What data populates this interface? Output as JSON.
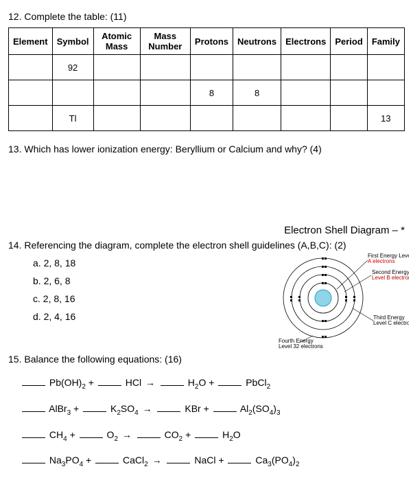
{
  "q12": {
    "heading": "12. Complete the table: (11)",
    "headers": [
      "Element",
      "Symbol",
      "Atomic Mass",
      "Mass Number",
      "Protons",
      "Neutrons",
      "Electrons",
      "Period",
      "Family"
    ],
    "rows": [
      [
        "",
        "92",
        "",
        "",
        "",
        "",
        "",
        "",
        ""
      ],
      [
        "",
        "",
        "",
        "",
        "8",
        "8",
        "",
        "",
        ""
      ],
      [
        "",
        "Tl",
        "",
        "",
        "",
        "",
        "",
        "",
        "13"
      ]
    ]
  },
  "q13": {
    "heading": "13. Which has lower ionization energy: Beryllium or Calcium and why? (4)"
  },
  "q14": {
    "title": "Electron Shell Diagram – *",
    "heading": "14. Referencing the diagram, complete the electron shell guidelines (A,B,C): (2)",
    "opts": {
      "a": "a.   2, 8, 18",
      "b": "b.   2, 6, 8",
      "c": "c.   2, 8, 16",
      "d": "d.   2, 4, 16"
    },
    "labels": {
      "first1": "First Energy Level",
      "firstA": "A electrons",
      "second1": "Second Energy",
      "secondB": "Level B electrons",
      "third1": "Third Energy",
      "thirdC": "Level C electrons",
      "fourth1": "Fourth Energy",
      "fourth2": "Level 32 electrons"
    }
  },
  "q15": {
    "heading": "15. Balance the following equations: (16)",
    "eq1": {
      "a": "Pb(OH)",
      "as": "2",
      "plus": "+",
      "b": "HCl",
      "arr": "→",
      "c": "H",
      "cs": "2",
      "cO": "O",
      "d": "PbCl",
      "ds": "2"
    },
    "eq2": {
      "a": "AlBr",
      "as": "3",
      "b": "K",
      "bs": "2",
      "bSO": "SO",
      "bsos": "4",
      "c": "KBr",
      "d": "Al",
      "ds": "2",
      "dSO": "(SO",
      "dsos": "4",
      "dend": ")",
      "dends": "3"
    },
    "eq3": {
      "a": "CH",
      "as": "4",
      "b": "O",
      "bs": "2",
      "c": "CO",
      "cs": "2",
      "d": "H",
      "ds": "2",
      "dO": "O"
    },
    "eq4": {
      "a": "Na",
      "as": "3",
      "aPO": "PO",
      "apos": "4",
      "b": "CaCl",
      "bs": "2",
      "c": "NaCl",
      "d": "Ca",
      "ds": "3",
      "dPO": "(PO",
      "dpos": "4",
      "dend": ")",
      "dends": "2"
    }
  }
}
